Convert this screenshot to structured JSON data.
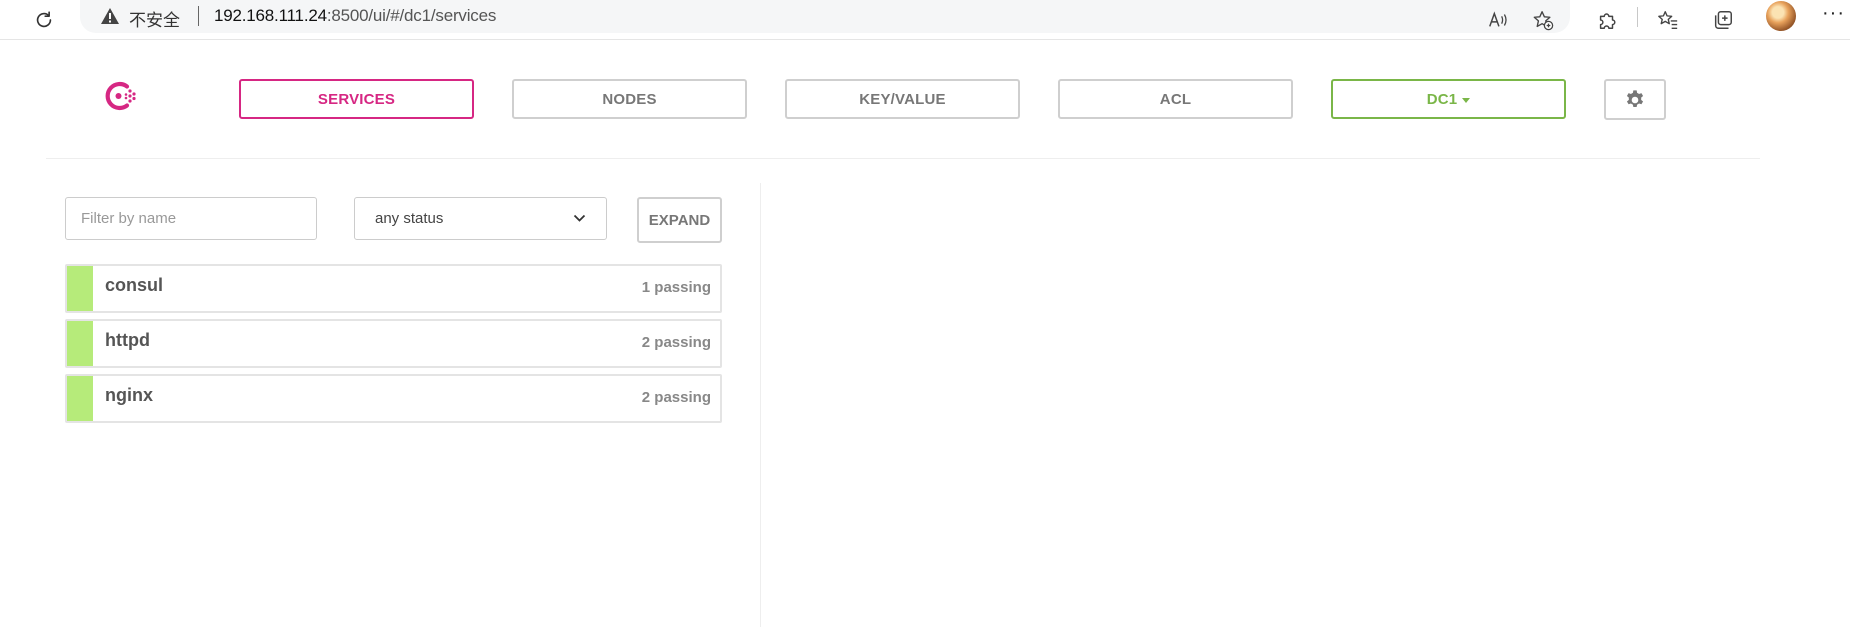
{
  "browser": {
    "insecure_label": "不安全",
    "url_host": "192.168.111.24",
    "url_path": ":8500/ui/#/dc1/services",
    "read_aloud_icon": "read-aloud-icon",
    "favorite_icon": "add-favorite-icon",
    "extensions_icon": "extensions-icon",
    "favorites_icon": "favorites-icon",
    "collections_icon": "collections-icon",
    "more_label": "···"
  },
  "nav": {
    "services": "SERVICES",
    "nodes": "NODES",
    "key_value": "KEY/VALUE",
    "acl": "ACL",
    "datacenter": "DC1"
  },
  "filters": {
    "name_placeholder": "Filter by name",
    "name_value": "",
    "status_selected": "any status",
    "expand_label": "EXPAND"
  },
  "services": [
    {
      "name": "consul",
      "checks": "1 passing",
      "status": "passing"
    },
    {
      "name": "httpd",
      "checks": "2 passing",
      "status": "passing"
    },
    {
      "name": "nginx",
      "checks": "2 passing",
      "status": "passing"
    }
  ],
  "colors": {
    "brand": "#d62783",
    "datacenter": "#7ab648",
    "passing": "#b6eb7a",
    "border": "#cfcfcf"
  }
}
